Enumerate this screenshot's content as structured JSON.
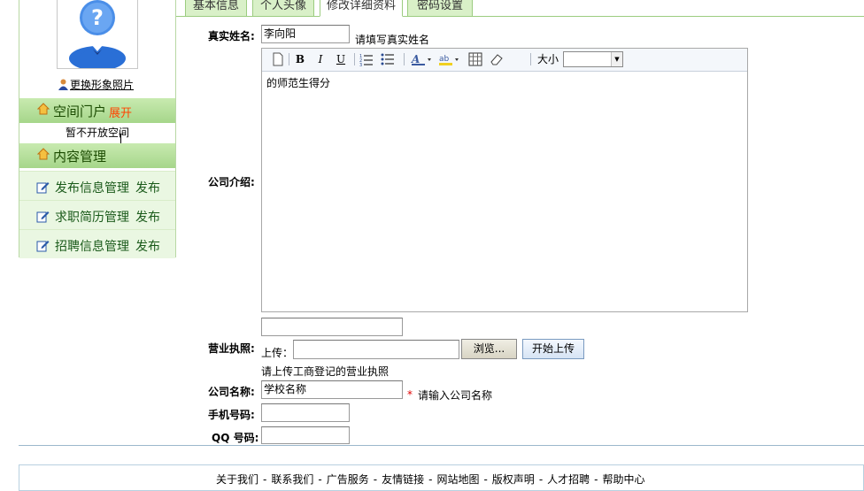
{
  "sidebar": {
    "change_photo": "更换形象照片",
    "space_portal": {
      "label": "空间门户",
      "expand": "展开",
      "status": "暂不开放空间"
    },
    "content_mgmt": {
      "label": "内容管理"
    },
    "menu": [
      {
        "label": "发布信息管理",
        "action": "发布"
      },
      {
        "label": "求职简历管理",
        "action": "发布"
      },
      {
        "label": "招聘信息管理",
        "action": "发布"
      }
    ]
  },
  "tabs": [
    "基本信息",
    "个人头像",
    "修改详细资料",
    "密码设置"
  ],
  "form": {
    "real_name": {
      "label": "真实姓名:",
      "value": "李向阳",
      "hint": "请填写真实姓名"
    },
    "company_intro": {
      "label": "公司介绍:",
      "content": "的师范生得分",
      "size_label": "大小"
    },
    "license": {
      "label": "营业执照:",
      "upload_label": "上传：",
      "browse": "浏览...",
      "start_upload": "开始上传",
      "hint": "请上传工商登记的营业执照"
    },
    "company_name": {
      "label": "公司名称:",
      "value": "学校名称",
      "required": "*",
      "hint": "请输入公司名称"
    },
    "mobile": {
      "label": "手机号码:",
      "value": ""
    },
    "qq": {
      "label": "QQ 号码:",
      "value": ""
    }
  },
  "footer": {
    "links": [
      "关于我们",
      "联系我们",
      "广告服务",
      "友情链接",
      "网站地图",
      "版权声明",
      "人才招聘",
      "帮助中心"
    ],
    "separator": "-"
  },
  "colors": {
    "green_bar": "#a6d68a",
    "menu_bg": "#eaf7e2",
    "tab_bg": "#d9f0c8",
    "expand": "#ff4400",
    "required": "#e00000"
  }
}
